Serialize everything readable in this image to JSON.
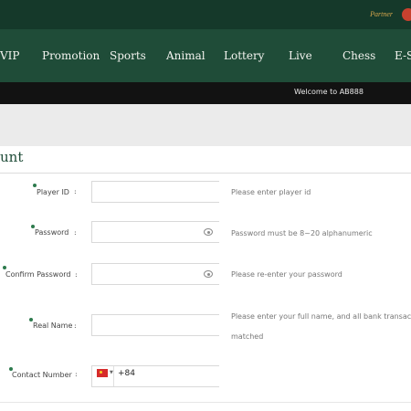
{
  "topbar": {
    "partner_label": "Partner"
  },
  "nav": {
    "items": [
      {
        "label": "VIP"
      },
      {
        "label": "Promotion"
      },
      {
        "label": "Sports"
      },
      {
        "label": "Animal"
      },
      {
        "label": "Lottery"
      },
      {
        "label": "Live"
      },
      {
        "label": "Chess"
      },
      {
        "label": "E-S"
      }
    ]
  },
  "ticker": {
    "text": "Welcome to AB888"
  },
  "form": {
    "heading": "unt",
    "fields": [
      {
        "label": "Player ID",
        "hint": "Please enter player id"
      },
      {
        "label": "Password",
        "hint": "Password must be 8~20 alphanumeric"
      },
      {
        "label": "Confirm Password",
        "hint": "Please re-enter your password"
      },
      {
        "label": "Real Name",
        "hint": "Please enter your full name, and all bank transaction",
        "hint2": "matched"
      },
      {
        "label": "Contact Number",
        "dial_code": "+84"
      }
    ],
    "colon": ":"
  },
  "colors": {
    "topbar": "#15392a",
    "nav": "#1f4c38",
    "accent": "#d6a64d",
    "required_mark": "#2d7a4d"
  }
}
